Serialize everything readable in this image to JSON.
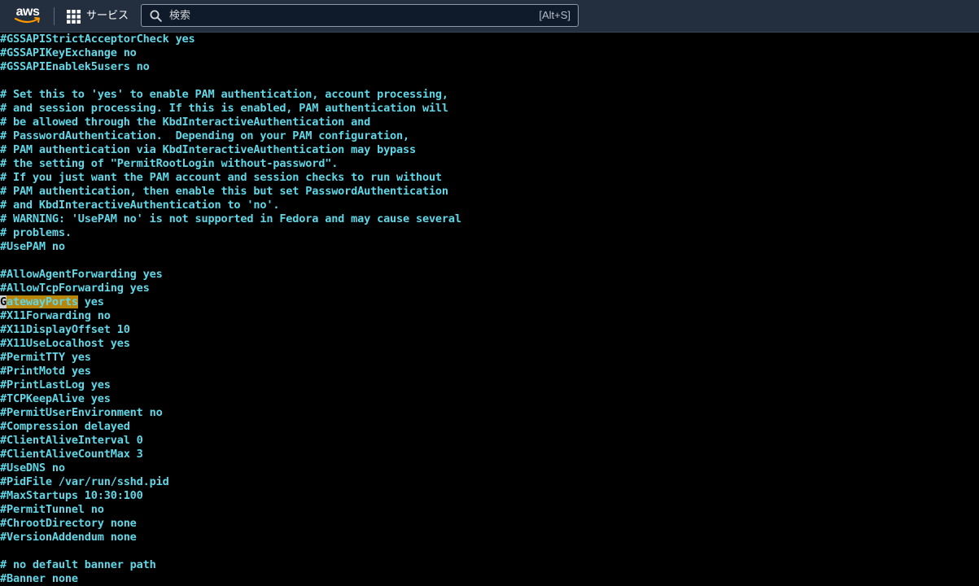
{
  "topbar": {
    "logo_text": "aws",
    "services_label": "サービス",
    "search": {
      "placeholder": "検索",
      "value": "",
      "shortcut": "[Alt+S]"
    }
  },
  "colors": {
    "topbar_bg": "#232f3e",
    "terminal_bg": "#000000",
    "terminal_text": "#5fd7e7",
    "highlight_bg": "#b8860b",
    "aws_smile": "#ff9900"
  },
  "icons": {
    "logo": "aws-logo-icon",
    "services": "grid-icon",
    "search": "search-icon"
  },
  "terminal": {
    "lines": [
      "#GSSAPIStrictAcceptorCheck yes",
      "#GSSAPIKeyExchange no",
      "#GSSAPIEnablek5users no",
      "",
      "# Set this to 'yes' to enable PAM authentication, account processing,",
      "# and session processing. If this is enabled, PAM authentication will",
      "# be allowed through the KbdInteractiveAuthentication and",
      "# PasswordAuthentication.  Depending on your PAM configuration,",
      "# PAM authentication via KbdInteractiveAuthentication may bypass",
      "# the setting of \"PermitRootLogin without-password\".",
      "# If you just want the PAM account and session checks to run without",
      "# PAM authentication, then enable this but set PasswordAuthentication",
      "# and KbdInteractiveAuthentication to 'no'.",
      "# WARNING: 'UsePAM no' is not supported in Fedora and may cause several",
      "# problems.",
      "#UsePAM no",
      "",
      "#AllowAgentForwarding yes",
      "#AllowTcpForwarding yes",
      "GatewayPorts yes",
      "#X11Forwarding no",
      "#X11DisplayOffset 10",
      "#X11UseLocalhost yes",
      "#PermitTTY yes",
      "#PrintMotd yes",
      "#PrintLastLog yes",
      "#TCPKeepAlive yes",
      "#PermitUserEnvironment no",
      "#Compression delayed",
      "#ClientAliveInterval 0",
      "#ClientAliveCountMax 3",
      "#UseDNS no",
      "#PidFile /var/run/sshd.pid",
      "#MaxStartups 10:30:100",
      "#PermitTunnel no",
      "#ChrootDirectory none",
      "#VersionAddendum none",
      "",
      "# no default banner path",
      "#Banner none"
    ],
    "highlight": {
      "line": 19,
      "cursor_char": "G",
      "highlighted": "atewayPorts",
      "rest": " yes"
    }
  }
}
